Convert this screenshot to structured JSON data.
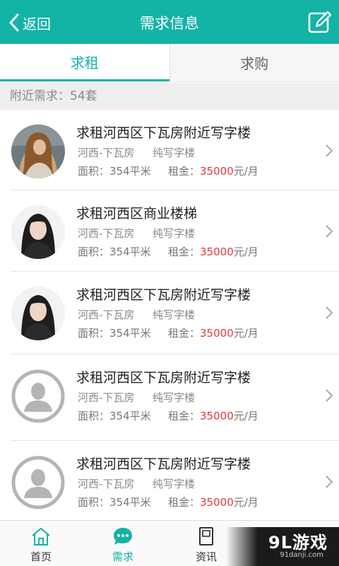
{
  "header": {
    "back_label": "返回",
    "title": "需求信息"
  },
  "tabs": [
    {
      "label": "求租",
      "active": true
    },
    {
      "label": "求购",
      "active": false
    }
  ],
  "nearby_summary": "附近需求：54套",
  "labels": {
    "area_prefix": "面积：",
    "rent_prefix": "租金：",
    "rent_unit": "元/月"
  },
  "listings": [
    {
      "title": "求租河西区下瓦房附近写字楼",
      "location": "河西-下瓦房",
      "type": "纯写字楼",
      "area": "354平米",
      "rent": "35000",
      "avatar": "photo-dark-hair"
    },
    {
      "title": "求租河西区商业楼梯",
      "location": "河西-下瓦房",
      "type": "纯写字楼",
      "area": "354平米",
      "rent": "35000",
      "avatar": "photo-woman"
    },
    {
      "title": "求租河西区下瓦房附近写字楼",
      "location": "河西-下瓦房",
      "type": "纯写字楼",
      "area": "354平米",
      "rent": "35000",
      "avatar": "photo-woman"
    },
    {
      "title": "求租河西区下瓦房附近写字楼",
      "location": "河西-下瓦房",
      "type": "纯写字楼",
      "area": "354平米",
      "rent": "35000",
      "avatar": "default-user"
    },
    {
      "title": "求租河西区下瓦房附近写字楼",
      "location": "河西-下瓦房",
      "type": "纯写字楼",
      "area": "354平米",
      "rent": "35000",
      "avatar": "default-user"
    }
  ],
  "bottom_nav": [
    {
      "label": "首页",
      "icon": "home-icon",
      "active": false
    },
    {
      "label": "需求",
      "icon": "chat-icon",
      "active": true
    },
    {
      "label": "资讯",
      "icon": "news-icon",
      "active": false
    }
  ],
  "watermark": {
    "brand": "9L游戏",
    "site": "91danji.com"
  },
  "colors": {
    "accent": "#13b3a6",
    "price": "#e8363a"
  }
}
